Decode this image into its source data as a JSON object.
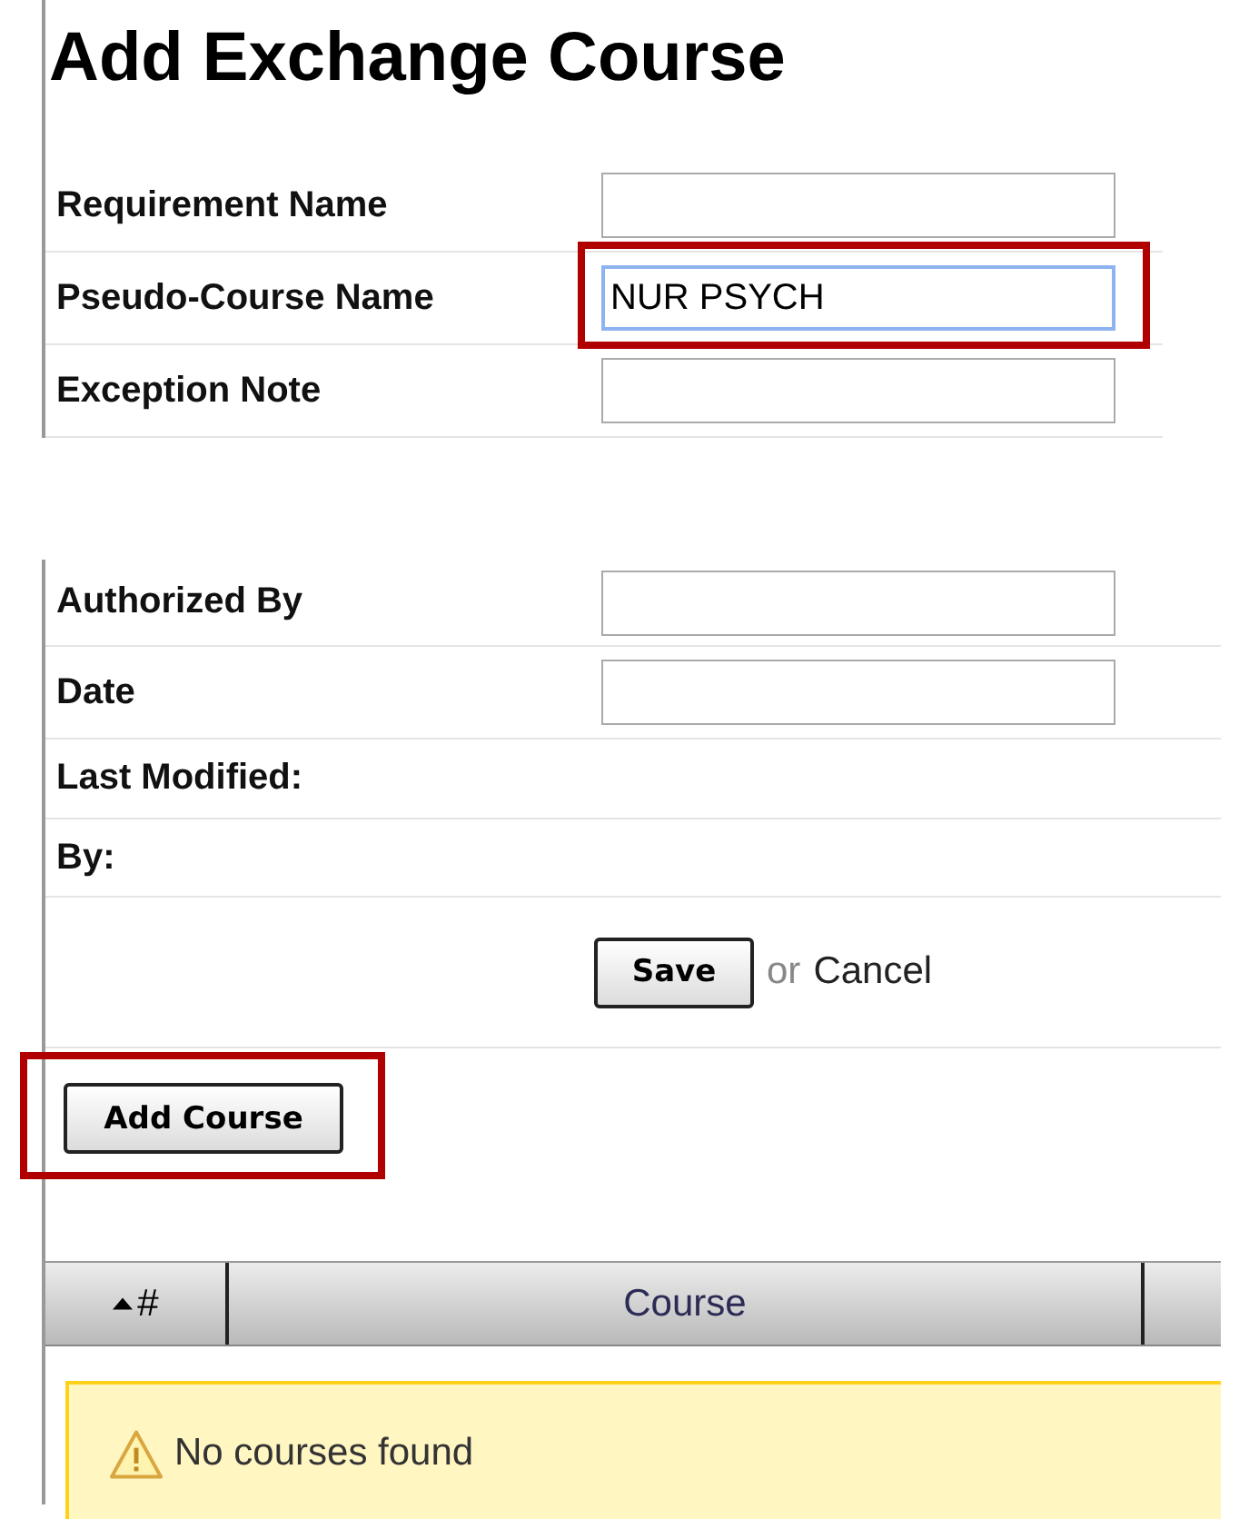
{
  "title": "Add Exchange Course",
  "sections": [
    {
      "rows": [
        {
          "label": "Requirement Name",
          "kind": "input",
          "focused": false,
          "highlighted": false
        },
        {
          "label": "Pseudo-Course Name",
          "kind": "input",
          "value": "NUR PSYCH",
          "focused": true,
          "highlighted": true
        },
        {
          "label": "Exception Note",
          "kind": "input",
          "focused": false,
          "highlighted": false
        }
      ]
    },
    {
      "rows": [
        {
          "label": "Authorized By",
          "kind": "input",
          "focused": false,
          "highlighted": false
        },
        {
          "label": "Date",
          "kind": "input",
          "focused": false,
          "highlighted": false
        },
        {
          "label": "Last Modified:",
          "kind": "text"
        },
        {
          "label": "By:",
          "kind": "text"
        }
      ]
    }
  ],
  "actions": {
    "save": "Save",
    "or": "or",
    "cancel": "Cancel"
  },
  "add_button": {
    "label": "Add Course",
    "highlighted": true
  },
  "table": {
    "columns": [
      {
        "label": "#",
        "sorted": true
      },
      {
        "label": "Course",
        "sorted": false
      }
    ],
    "empty_message": "No courses found"
  }
}
